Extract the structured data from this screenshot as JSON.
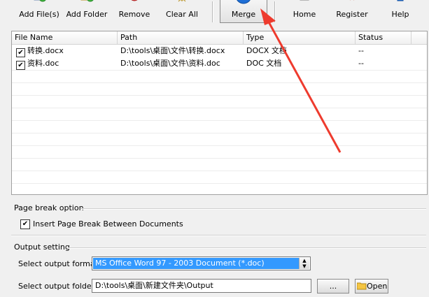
{
  "toolbar": {
    "buttons": [
      {
        "label": "Add File(s)",
        "icon": "add-file-icon"
      },
      {
        "label": "Add Folder",
        "icon": "add-folder-icon"
      },
      {
        "label": "Remove",
        "icon": "remove-icon"
      },
      {
        "label": "Clear All",
        "icon": "clear-all-icon"
      },
      {
        "label": "Merge",
        "icon": "merge-play-icon"
      },
      {
        "label": "Home",
        "icon": "home-icon"
      },
      {
        "label": "Register",
        "icon": "register-icon"
      },
      {
        "label": "Help",
        "icon": "help-icon"
      }
    ]
  },
  "file_list": {
    "columns": [
      "File Name",
      "Path",
      "Type",
      "Status"
    ],
    "rows": [
      {
        "checked": true,
        "name": "转换.docx",
        "path": "D:\\tools\\桌面\\文件\\转换.docx",
        "type": "DOCX 文档",
        "status": "--"
      },
      {
        "checked": true,
        "name": "资料.doc",
        "path": "D:\\tools\\桌面\\文件\\资料.doc",
        "type": "DOC 文档",
        "status": "--"
      }
    ]
  },
  "page_break": {
    "title": "Page break option",
    "checkbox_label": "Insert Page Break Between Documents",
    "checked": true
  },
  "output": {
    "title": "Output setting",
    "format_label": "Select output format:",
    "format_value": "MS Office Word 97 - 2003 Document (*.doc)",
    "folder_label": "Select output folder:",
    "folder_value": "D:\\tools\\桌面\\新建文件夹\\Output",
    "browse_label": "...",
    "open_label": "Open"
  },
  "colors": {
    "accent": "#3399ff",
    "annotation_arrow": "#ee3b2e"
  }
}
